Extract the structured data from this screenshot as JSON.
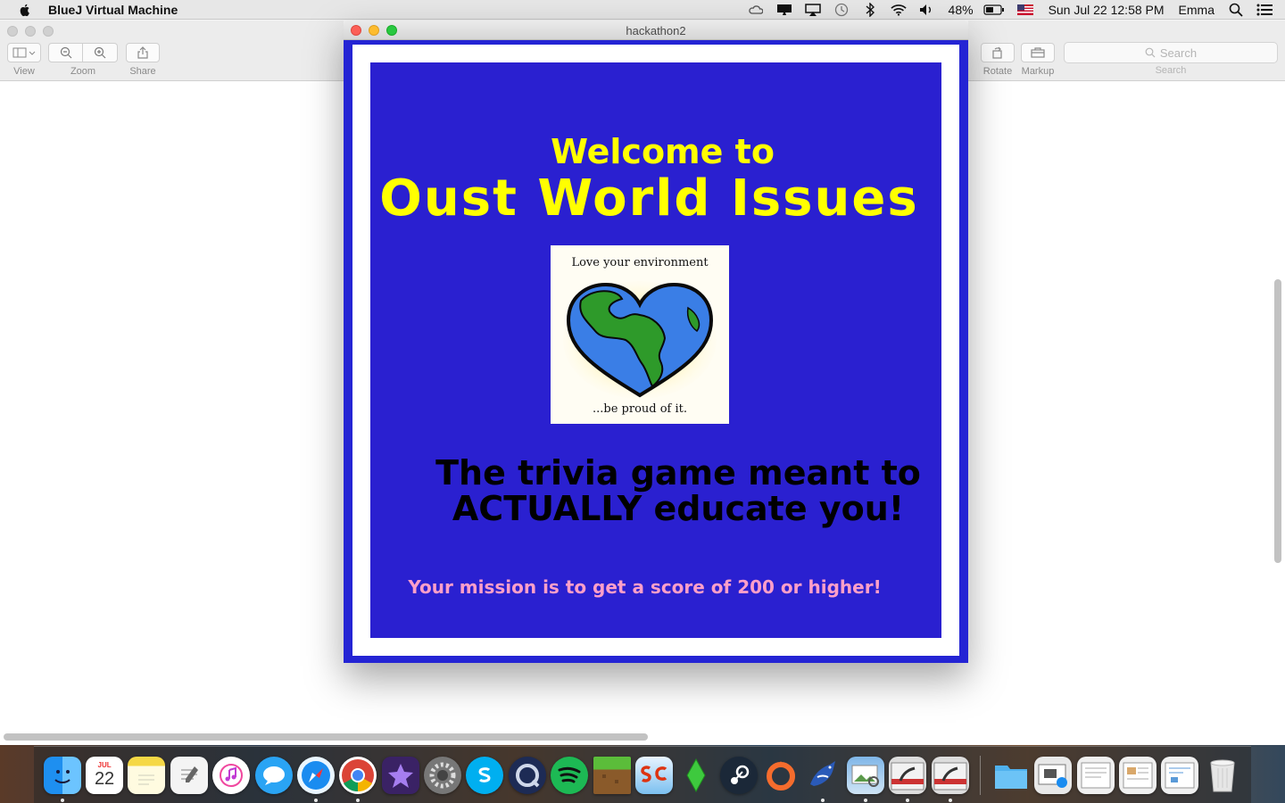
{
  "menubar": {
    "app_name": "BlueJ Virtual Machine",
    "battery": "48%",
    "datetime": "Sun Jul 22  12:58 PM",
    "user": "Emma",
    "icons": [
      "apple-icon",
      "creative-cloud-icon",
      "display-icon",
      "airplay-icon",
      "time-machine-icon",
      "bluetooth-icon",
      "wifi-icon",
      "volume-icon",
      "battery-icon",
      "flag-icon",
      "spotlight-icon",
      "notification-center-icon"
    ]
  },
  "preview": {
    "toolbar": {
      "view_label": "View",
      "zoom_label": "Zoom",
      "share_label": "Share",
      "rotate_label": "Rotate",
      "markup_label": "Markup",
      "search_placeholder": "Search",
      "search_label": "Search"
    }
  },
  "game_window": {
    "title": "hackathon2",
    "welcome": "Welcome to",
    "game_name": "Oust World Issues",
    "poster_top": "Love your environment",
    "poster_bottom": "...be proud of it.",
    "tagline_line1": "The trivia game meant to",
    "tagline_line2": "ACTUALLY educate you!",
    "mission": "Your mission is to get a score of 200 or higher!",
    "colors": {
      "frame": "#2424d4",
      "panel": "#2a20d0",
      "title_text": "#ffff00",
      "tagline_text": "#000000",
      "mission_text": "#ff9fc9"
    }
  },
  "dock": {
    "calendar_month": "JUL",
    "calendar_day": "22",
    "items": [
      "finder",
      "calendar",
      "notes",
      "textedit",
      "itunes",
      "messages",
      "safari",
      "chrome",
      "imovie",
      "system-preferences",
      "skype",
      "quicktime",
      "spotify",
      "minecraft",
      "sc-app",
      "sims",
      "steam",
      "origin",
      "bluej",
      "preview",
      "bluej-window-1",
      "bluej-window-2",
      "folder",
      "screenshot-1",
      "screenshot-2",
      "screenshot-3",
      "screenshot-4",
      "trash"
    ]
  }
}
